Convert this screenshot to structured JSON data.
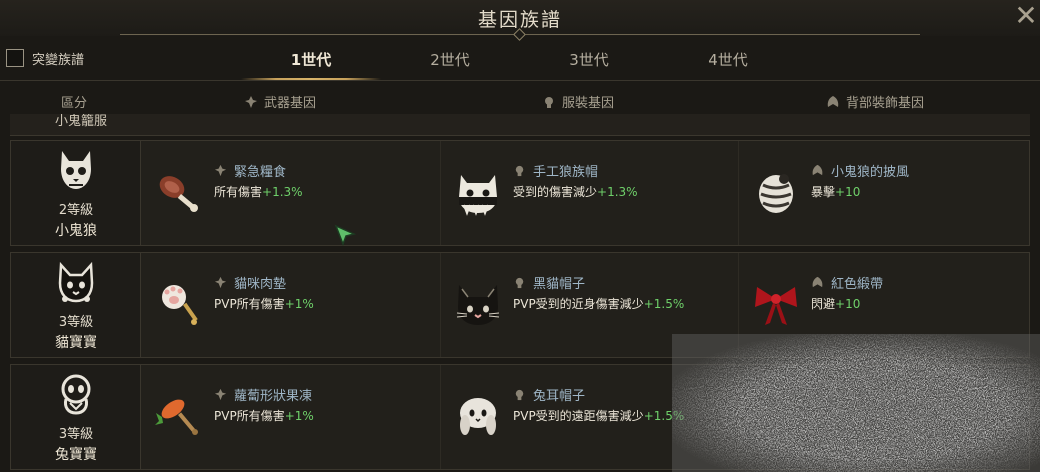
{
  "window": {
    "title": "基因族譜",
    "close_glyph": "✕"
  },
  "filter": {
    "mutation_label": "突變族譜",
    "checked": false
  },
  "tabs": [
    {
      "label": "1世代",
      "active": true
    },
    {
      "label": "2世代",
      "active": false
    },
    {
      "label": "3世代",
      "active": false
    },
    {
      "label": "4世代",
      "active": false
    }
  ],
  "columns": {
    "category": "區分",
    "weapon": "武器基因",
    "costume": "服裝基因",
    "back": "背部裝飾基因"
  },
  "partial_row": {
    "name": "小鬼籠服"
  },
  "rows": [
    {
      "level": "2等級",
      "name": "小鬼狼",
      "icon": "wolf-skull-icon",
      "weapon": {
        "name": "緊急糧食",
        "stat": "所有傷害",
        "value": "+1.3%",
        "icon": "meat-leg-icon"
      },
      "costume": {
        "name": "手工狼族帽",
        "stat": "受到的傷害減少",
        "value": "+1.3%",
        "icon": "wolf-skull-hat-icon"
      },
      "back": {
        "name": "小鬼狼的披風",
        "stat": "暴擊",
        "value": "+10",
        "icon": "striped-cape-icon"
      }
    },
    {
      "level": "3等級",
      "name": "貓寶寶",
      "icon": "cat-face-icon",
      "weapon": {
        "name": "貓咪肉墊",
        "stat": "PVP所有傷害",
        "value": "+1%",
        "icon": "paw-wand-icon"
      },
      "costume": {
        "name": "黑貓帽子",
        "stat": "PVP受到的近身傷害減少",
        "value": "+1.5%",
        "icon": "black-cat-hat-icon"
      },
      "back": {
        "name": "紅色緞帶",
        "stat": "閃避",
        "value": "+10",
        "icon": "red-ribbon-icon"
      }
    },
    {
      "level": "3等級",
      "name": "兔寶寶",
      "icon": "rabbit-face-icon",
      "weapon": {
        "name": "蘿蔔形狀果凍",
        "stat": "PVP所有傷害",
        "value": "+1%",
        "icon": "carrot-hammer-icon"
      },
      "costume": {
        "name": "兔耳帽子",
        "stat": "PVP受到的遠距傷害減少",
        "value": "+1.5%",
        "icon": "bunny-hat-icon"
      },
      "back": null
    }
  ],
  "colors": {
    "stat_value": "#6fd06a",
    "item_name": "#9fb6c7",
    "active_tab_underline": "#c8a25c"
  }
}
